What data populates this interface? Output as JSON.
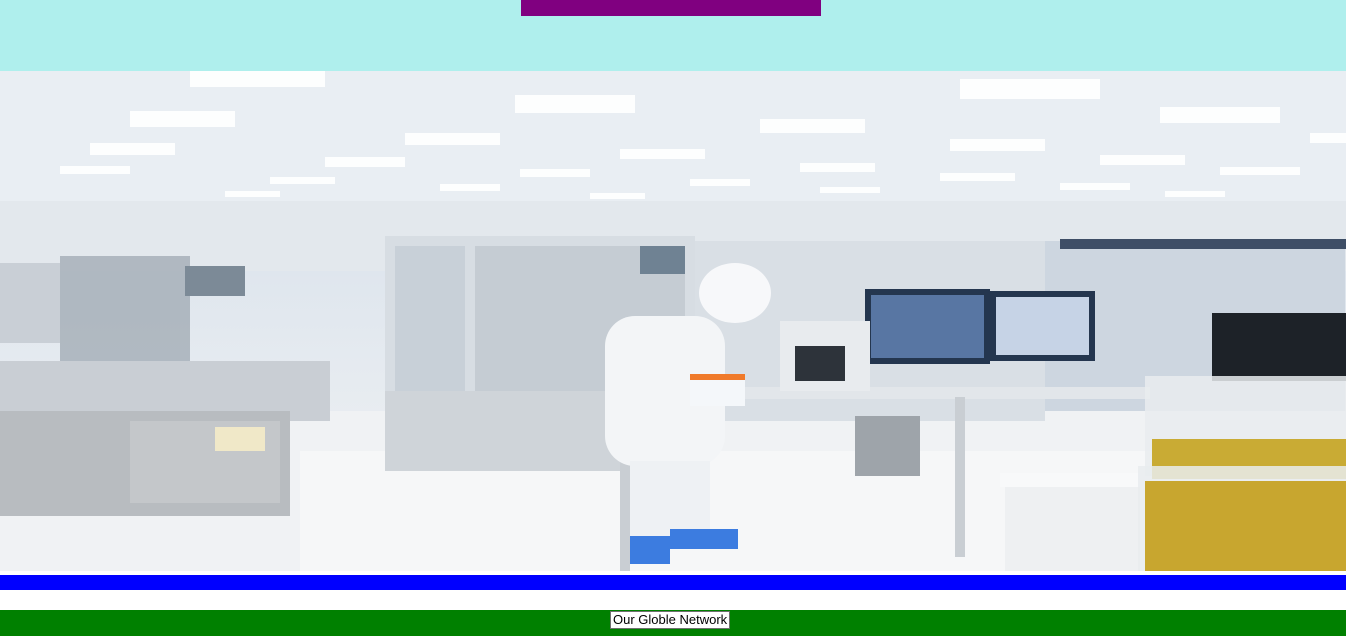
{
  "colors": {
    "header_background": "#afefed",
    "top_accent_bar": "#800080",
    "divider_bar": "#0000ff",
    "footer_band": "#008000"
  },
  "hero": {
    "image_icon": "laboratory-photo"
  },
  "footer": {
    "network_button_label": "Our Globle Network"
  }
}
